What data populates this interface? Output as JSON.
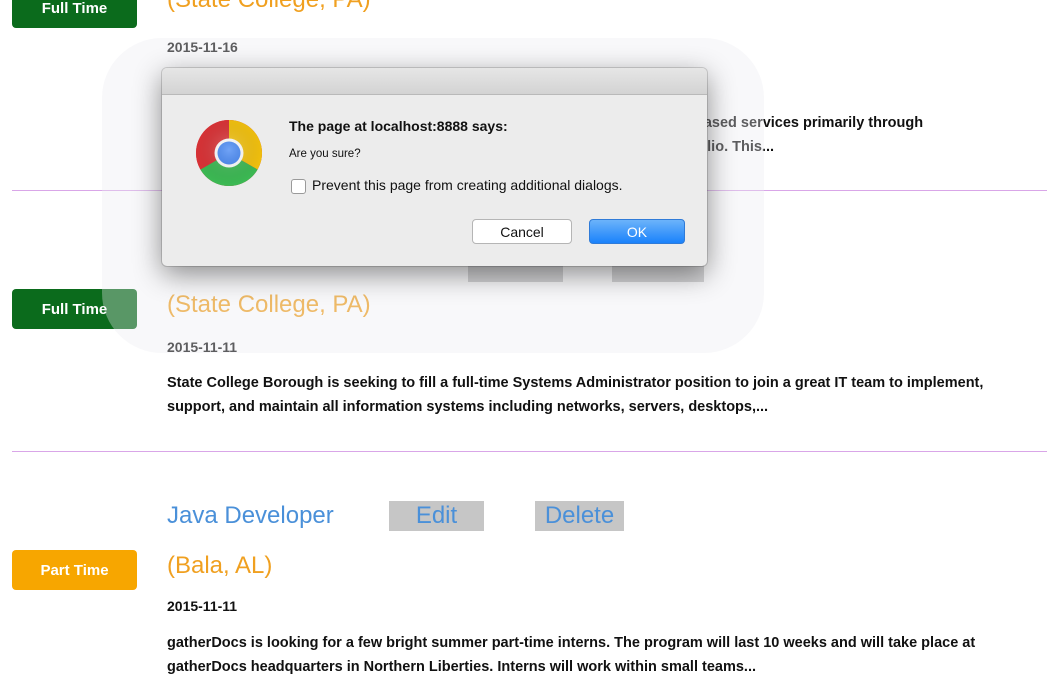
{
  "jobs": [
    {
      "type_label": "Full Time",
      "location": "(State College, PA)",
      "date": "2015-11-16",
      "description_visible": [
        "based services primarily through",
        "rtfolio. This..."
      ]
    },
    {
      "type_label": "Full Time",
      "location": "(State College, PA)",
      "date": "2015-11-11",
      "description": "State College Borough is seeking to fill a full-time Systems Administrator position to join a great IT team to implement, support, and maintain all information systems including networks, servers, desktops,..."
    },
    {
      "type_label": "Part Time",
      "title": "Java Developer",
      "edit_label": "Edit",
      "delete_label": "Delete",
      "location": "(Bala, AL)",
      "date": "2015-11-11",
      "description": "gatherDocs is looking for a few bright summer part-time interns. The program will last 10 weeks and will take place at gatherDocs headquarters in Northern Liberties. Interns will work within small teams..."
    }
  ],
  "dialog": {
    "heading": "The page at localhost:8888 says:",
    "message": "Are you sure?",
    "checkbox_label": "Prevent this page from creating additional dialogs.",
    "checkbox_checked": false,
    "cancel_label": "Cancel",
    "ok_label": "OK",
    "icon": "chrome-icon"
  },
  "colors": {
    "full_time_badge": "#0b6b1c",
    "part_time_badge": "#f7a600",
    "title": "#4a90d9",
    "location": "#f0a020",
    "divider": "#d9a6e8"
  }
}
